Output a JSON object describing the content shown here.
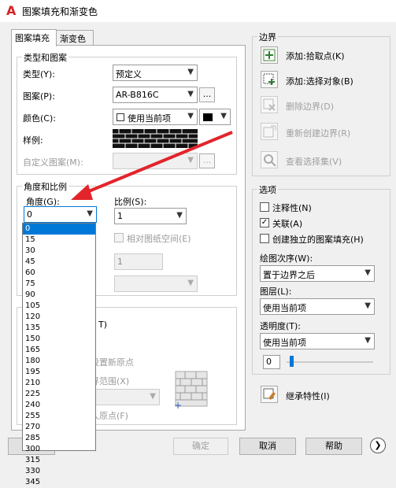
{
  "window": {
    "title": "图案填充和渐变色"
  },
  "tabs": [
    {
      "label": "图案填充"
    },
    {
      "label": "渐变色"
    }
  ],
  "type_pattern": {
    "title": "类型和图案",
    "type_label": "类型(Y):",
    "type_value": "预定义",
    "pattern_label": "图案(P):",
    "pattern_value": "AR-B816C",
    "color_label": "颜色(C):",
    "color_value": "使用当前项",
    "sample_label": "样例:",
    "custom_label": "自定义图案(M):",
    "dots": "..."
  },
  "angle_scale": {
    "title": "角度和比例",
    "angle_label": "角度(G):",
    "angle_value": "0",
    "scale_label": "比例(S):",
    "scale_value": "1",
    "relative_label": "相对图纸空间(E)",
    "spacing_value": "1"
  },
  "origin": {
    "suffix_t": "T)",
    "set_new_origin": "设置新原点",
    "extent_label": "界范围(X)",
    "store_origin": "人原点(F)"
  },
  "angle_options": [
    "0",
    "15",
    "30",
    "45",
    "60",
    "75",
    "90",
    "105",
    "120",
    "135",
    "150",
    "165",
    "180",
    "195",
    "210",
    "225",
    "240",
    "255",
    "270",
    "285",
    "300",
    "315",
    "330",
    "345"
  ],
  "boundaries": {
    "title": "边界",
    "add_pick": "添加:拾取点(K)",
    "add_select": "添加:选择对象(B)",
    "remove": "删除边界(D)",
    "recreate": "重新创建边界(R)",
    "view_selection": "查看选择集(V)"
  },
  "options": {
    "title": "选项",
    "annotative": "注释性(N)",
    "associative": "关联(A)",
    "independent": "创建独立的图案填充(H)",
    "draw_order_label": "绘图次序(W):",
    "draw_order_value": "置于边界之后",
    "layer_label": "图层(L):",
    "layer_value": "使用当前项",
    "transparency_label": "透明度(T):",
    "transparency_value": "使用当前项",
    "transparency_number": "0",
    "inherit": "继承特性(I)"
  },
  "footer": {
    "ok": "确定",
    "cancel": "取消",
    "help": "帮助"
  }
}
